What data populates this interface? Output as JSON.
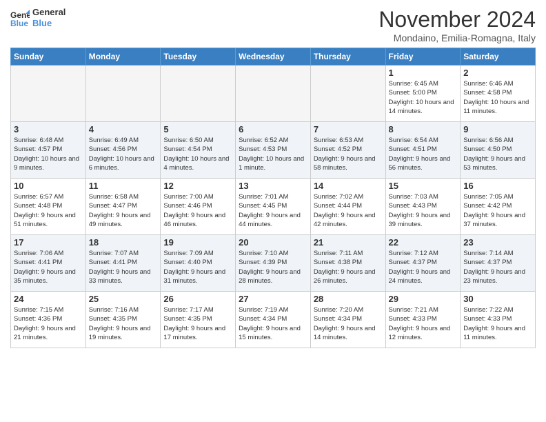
{
  "logo": {
    "line1": "General",
    "line2": "Blue"
  },
  "title": "November 2024",
  "location": "Mondaino, Emilia-Romagna, Italy",
  "weekdays": [
    "Sunday",
    "Monday",
    "Tuesday",
    "Wednesday",
    "Thursday",
    "Friday",
    "Saturday"
  ],
  "weeks": [
    [
      {
        "day": "",
        "info": ""
      },
      {
        "day": "",
        "info": ""
      },
      {
        "day": "",
        "info": ""
      },
      {
        "day": "",
        "info": ""
      },
      {
        "day": "",
        "info": ""
      },
      {
        "day": "1",
        "info": "Sunrise: 6:45 AM\nSunset: 5:00 PM\nDaylight: 10 hours and 14 minutes."
      },
      {
        "day": "2",
        "info": "Sunrise: 6:46 AM\nSunset: 4:58 PM\nDaylight: 10 hours and 11 minutes."
      }
    ],
    [
      {
        "day": "3",
        "info": "Sunrise: 6:48 AM\nSunset: 4:57 PM\nDaylight: 10 hours and 9 minutes."
      },
      {
        "day": "4",
        "info": "Sunrise: 6:49 AM\nSunset: 4:56 PM\nDaylight: 10 hours and 6 minutes."
      },
      {
        "day": "5",
        "info": "Sunrise: 6:50 AM\nSunset: 4:54 PM\nDaylight: 10 hours and 4 minutes."
      },
      {
        "day": "6",
        "info": "Sunrise: 6:52 AM\nSunset: 4:53 PM\nDaylight: 10 hours and 1 minute."
      },
      {
        "day": "7",
        "info": "Sunrise: 6:53 AM\nSunset: 4:52 PM\nDaylight: 9 hours and 58 minutes."
      },
      {
        "day": "8",
        "info": "Sunrise: 6:54 AM\nSunset: 4:51 PM\nDaylight: 9 hours and 56 minutes."
      },
      {
        "day": "9",
        "info": "Sunrise: 6:56 AM\nSunset: 4:50 PM\nDaylight: 9 hours and 53 minutes."
      }
    ],
    [
      {
        "day": "10",
        "info": "Sunrise: 6:57 AM\nSunset: 4:48 PM\nDaylight: 9 hours and 51 minutes."
      },
      {
        "day": "11",
        "info": "Sunrise: 6:58 AM\nSunset: 4:47 PM\nDaylight: 9 hours and 49 minutes."
      },
      {
        "day": "12",
        "info": "Sunrise: 7:00 AM\nSunset: 4:46 PM\nDaylight: 9 hours and 46 minutes."
      },
      {
        "day": "13",
        "info": "Sunrise: 7:01 AM\nSunset: 4:45 PM\nDaylight: 9 hours and 44 minutes."
      },
      {
        "day": "14",
        "info": "Sunrise: 7:02 AM\nSunset: 4:44 PM\nDaylight: 9 hours and 42 minutes."
      },
      {
        "day": "15",
        "info": "Sunrise: 7:03 AM\nSunset: 4:43 PM\nDaylight: 9 hours and 39 minutes."
      },
      {
        "day": "16",
        "info": "Sunrise: 7:05 AM\nSunset: 4:42 PM\nDaylight: 9 hours and 37 minutes."
      }
    ],
    [
      {
        "day": "17",
        "info": "Sunrise: 7:06 AM\nSunset: 4:41 PM\nDaylight: 9 hours and 35 minutes."
      },
      {
        "day": "18",
        "info": "Sunrise: 7:07 AM\nSunset: 4:41 PM\nDaylight: 9 hours and 33 minutes."
      },
      {
        "day": "19",
        "info": "Sunrise: 7:09 AM\nSunset: 4:40 PM\nDaylight: 9 hours and 31 minutes."
      },
      {
        "day": "20",
        "info": "Sunrise: 7:10 AM\nSunset: 4:39 PM\nDaylight: 9 hours and 28 minutes."
      },
      {
        "day": "21",
        "info": "Sunrise: 7:11 AM\nSunset: 4:38 PM\nDaylight: 9 hours and 26 minutes."
      },
      {
        "day": "22",
        "info": "Sunrise: 7:12 AM\nSunset: 4:37 PM\nDaylight: 9 hours and 24 minutes."
      },
      {
        "day": "23",
        "info": "Sunrise: 7:14 AM\nSunset: 4:37 PM\nDaylight: 9 hours and 23 minutes."
      }
    ],
    [
      {
        "day": "24",
        "info": "Sunrise: 7:15 AM\nSunset: 4:36 PM\nDaylight: 9 hours and 21 minutes."
      },
      {
        "day": "25",
        "info": "Sunrise: 7:16 AM\nSunset: 4:35 PM\nDaylight: 9 hours and 19 minutes."
      },
      {
        "day": "26",
        "info": "Sunrise: 7:17 AM\nSunset: 4:35 PM\nDaylight: 9 hours and 17 minutes."
      },
      {
        "day": "27",
        "info": "Sunrise: 7:19 AM\nSunset: 4:34 PM\nDaylight: 9 hours and 15 minutes."
      },
      {
        "day": "28",
        "info": "Sunrise: 7:20 AM\nSunset: 4:34 PM\nDaylight: 9 hours and 14 minutes."
      },
      {
        "day": "29",
        "info": "Sunrise: 7:21 AM\nSunset: 4:33 PM\nDaylight: 9 hours and 12 minutes."
      },
      {
        "day": "30",
        "info": "Sunrise: 7:22 AM\nSunset: 4:33 PM\nDaylight: 9 hours and 11 minutes."
      }
    ]
  ]
}
